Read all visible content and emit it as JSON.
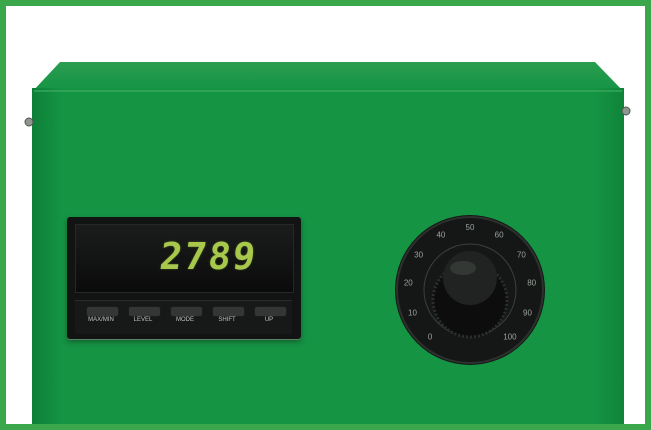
{
  "display": {
    "value": "2789"
  },
  "buttons": [
    {
      "label": "MAX/MIN"
    },
    {
      "label": "LEVEL"
    },
    {
      "label": "MODE"
    },
    {
      "label": "SHIFT"
    },
    {
      "label": "UP"
    }
  ],
  "dial": {
    "scale_labels": [
      "0",
      "10",
      "20",
      "30",
      "40",
      "50",
      "60",
      "70",
      "80",
      "90",
      "100"
    ]
  },
  "colors": {
    "frame_border": "#3aa84a",
    "enclosure": "#159444",
    "display_digits": "#a7c84b"
  }
}
